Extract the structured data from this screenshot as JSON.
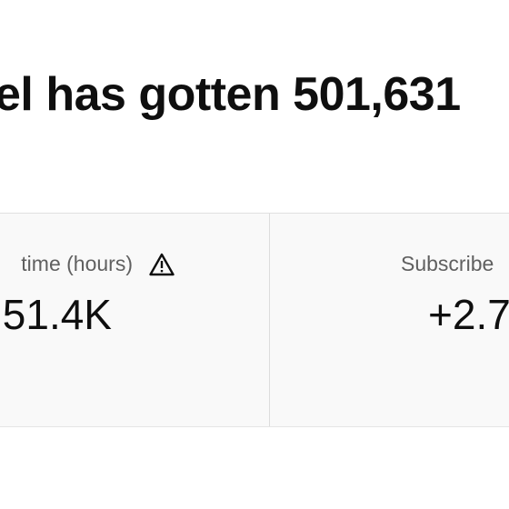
{
  "headline": "el has gotten 501,631",
  "metrics": {
    "watch_time": {
      "label": "time (hours)",
      "value": "51.4K",
      "icon": "warning-icon"
    },
    "subscribers": {
      "label": "Subscribe",
      "value": "+2.7"
    }
  }
}
